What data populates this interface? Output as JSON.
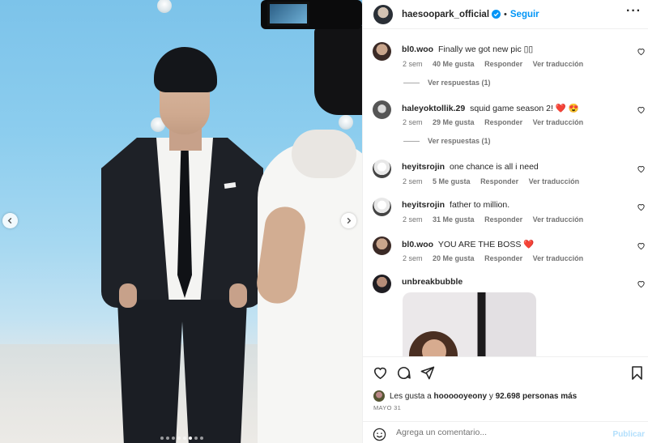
{
  "header": {
    "username": "haesoopark_official",
    "separator": "•",
    "follow_label": "Seguir",
    "more_label": "···"
  },
  "comments": [
    {
      "username": "bl0.woo",
      "text": "Finally we got new pic",
      "text_suffix": "▯▯",
      "time": "2 sem",
      "likes": "40 Me gusta",
      "reply": "Responder",
      "translate": "Ver traducción",
      "replies_label": "Ver respuestas (1)"
    },
    {
      "username": "haleyoktollik.29",
      "text": "squid game season 2!",
      "emoji": "❤️",
      "emoji2": "😍",
      "time": "2 sem",
      "likes": "29 Me gusta",
      "reply": "Responder",
      "translate": "Ver traducción",
      "replies_label": "Ver respuestas (1)"
    },
    {
      "username": "heyitsrojin",
      "text": "one chance is all i need",
      "time": "2 sem",
      "likes": "5 Me gusta",
      "reply": "Responder",
      "translate": "Ver traducción"
    },
    {
      "username": "heyitsrojin",
      "text": "father to million.",
      "time": "2 sem",
      "likes": "31 Me gusta",
      "reply": "Responder",
      "translate": "Ver traducción"
    },
    {
      "username": "bl0.woo",
      "text": "YOU ARE THE BOSS",
      "emoji": "❤️",
      "time": "2 sem",
      "likes": "20 Me gusta",
      "reply": "Responder",
      "translate": "Ver traducción"
    },
    {
      "username": "unbreakbubble"
    }
  ],
  "likes_line": {
    "prefix": "Les gusta a",
    "user": "hoooooyeony",
    "middle": "y",
    "count": "92.698 personas más"
  },
  "date": "MAYO 31",
  "add_comment": {
    "placeholder": "Agrega un comentario...",
    "publish_label": "Publicar"
  },
  "carousel": {
    "dot_count": 8,
    "active_index": 5
  },
  "colors": {
    "accent": "#0095f6",
    "heart": "#ed1c3a"
  }
}
